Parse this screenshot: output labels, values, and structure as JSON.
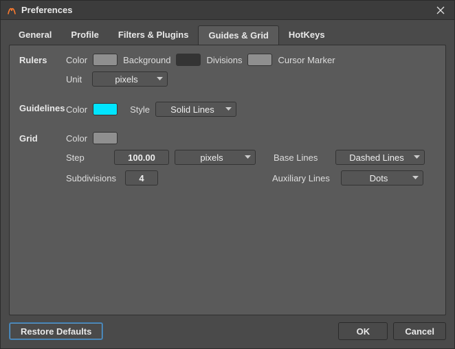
{
  "window": {
    "title": "Preferences"
  },
  "tabs": {
    "general": "General",
    "profile": "Profile",
    "filters": "Filters & Plugins",
    "guides": "Guides & Grid",
    "hotkeys": "HotKeys"
  },
  "sections": {
    "rulers": {
      "heading": "Rulers",
      "color_label": "Color",
      "background_label": "Background",
      "divisions_label": "Divisions",
      "cursor_marker_label": "Cursor Marker",
      "unit_label": "Unit",
      "unit_value": "pixels"
    },
    "guidelines": {
      "heading": "Guidelines",
      "color_label": "Color",
      "style_label": "Style",
      "style_value": "Solid Lines"
    },
    "grid": {
      "heading": "Grid",
      "color_label": "Color",
      "step_label": "Step",
      "step_value": "100.00",
      "step_unit": "pixels",
      "subdivisions_label": "Subdivisions",
      "subdivisions_value": "4",
      "baselines_label": "Base Lines",
      "baselines_value": "Dashed Lines",
      "auxlines_label": "Auxiliary Lines",
      "auxlines_value": "Dots"
    }
  },
  "footer": {
    "restore": "Restore Defaults",
    "ok": "OK",
    "cancel": "Cancel"
  },
  "colors": {
    "rulers_color": "#8f8f8f",
    "rulers_background": "#343434",
    "rulers_divisions": "#8f8f8f",
    "rulers_cursor_marker": "#8f8f8f",
    "guidelines_color": "#00e5ff",
    "grid_color": "#8f8f8f"
  }
}
